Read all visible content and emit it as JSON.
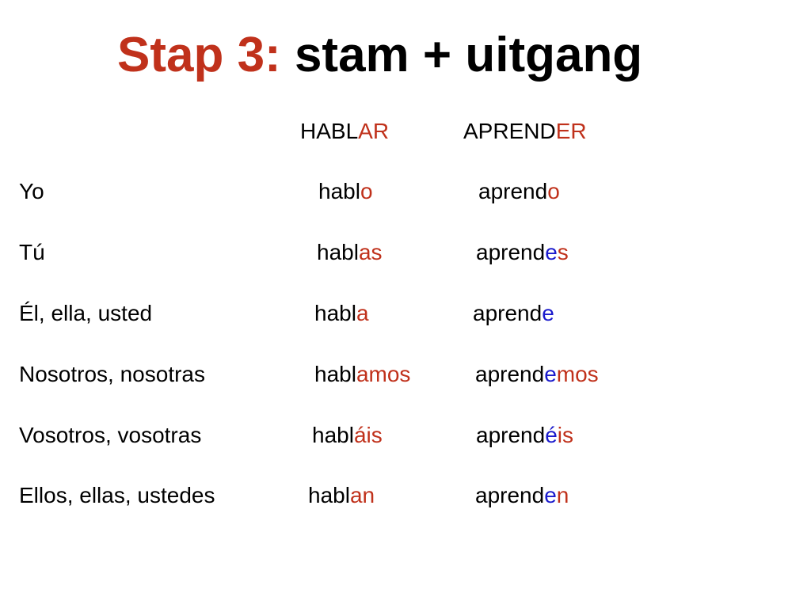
{
  "title": {
    "accent": "Stap 3:",
    "rest": " stam + uitgang"
  },
  "colors": {
    "ending_red": "#c0311b",
    "stem_vowel_blue": "#1a1acc",
    "text": "#000000"
  },
  "headers": {
    "hablar": {
      "stem": "HABL",
      "ending": "AR"
    },
    "aprender": {
      "stem": "APREND",
      "ending": "ER"
    }
  },
  "rows": [
    {
      "pronoun": "Yo",
      "hablar": {
        "stem": "habl",
        "ending": "o"
      },
      "aprender": {
        "stem": "aprend",
        "vowel": "",
        "ending": "o"
      }
    },
    {
      "pronoun": "Tú",
      "hablar": {
        "stem": "habl",
        "ending": "as"
      },
      "aprender": {
        "stem": "aprend",
        "vowel": "e",
        "ending": "s"
      }
    },
    {
      "pronoun": "Él, ella, usted",
      "hablar": {
        "stem": "habl",
        "ending": "a"
      },
      "aprender": {
        "stem": "aprend",
        "vowel": "e",
        "ending": ""
      }
    },
    {
      "pronoun": "Nosotros, nosotras",
      "hablar": {
        "stem": "habl",
        "ending": "amos"
      },
      "aprender": {
        "stem": "aprend",
        "vowel": "e",
        "ending": "mos"
      }
    },
    {
      "pronoun": "Vosotros, vosotras",
      "hablar": {
        "stem": "habl",
        "ending": "áis"
      },
      "aprender": {
        "stem": "aprend",
        "vowel": "é",
        "ending": "is"
      }
    },
    {
      "pronoun": "Ellos, ellas, ustedes",
      "hablar": {
        "stem": "habl",
        "ending": "an"
      },
      "aprender": {
        "stem": "aprend",
        "vowel": "e",
        "ending": "n"
      }
    }
  ]
}
